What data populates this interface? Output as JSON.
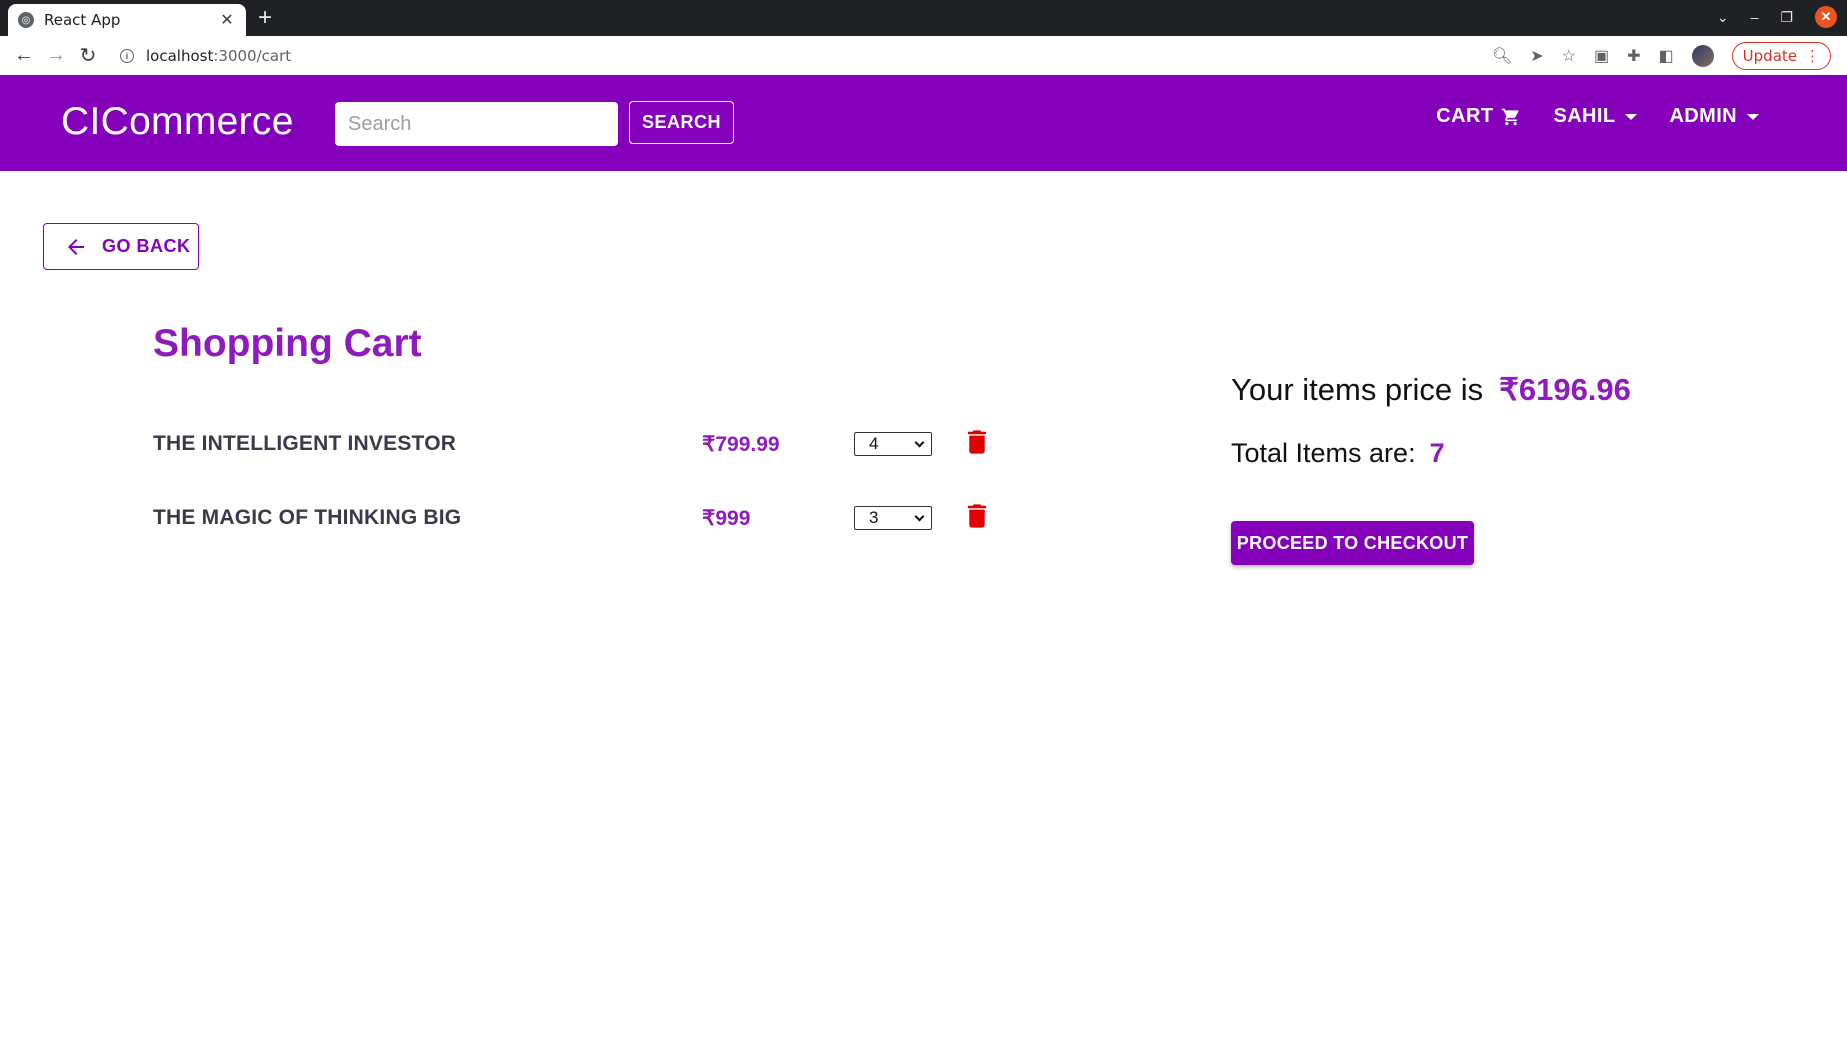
{
  "browser": {
    "tab_title": "React App",
    "url_host": "localhost",
    "url_path": ":3000/cart",
    "update_label": "Update",
    "profile_badge": "1"
  },
  "header": {
    "brand": "CICommerce",
    "search_placeholder": "Search",
    "search_button": "SEARCH",
    "nav": {
      "cart": "CART",
      "user": "SAHIL",
      "admin": "ADMIN"
    }
  },
  "page": {
    "go_back": "GO BACK",
    "title": "Shopping Cart",
    "items": [
      {
        "name": "THE INTELLIGENT INVESTOR",
        "price": "₹799.99",
        "qty": "4"
      },
      {
        "name": "THE MAGIC OF THINKING BIG",
        "price": "₹999",
        "qty": "3"
      }
    ],
    "summary": {
      "price_label": "Your items price is",
      "price_value": "₹6196.96",
      "items_label": "Total Items are:",
      "items_value": "7",
      "checkout": "PROCEED TO CHECKOUT"
    }
  },
  "colors": {
    "primary": "#8400bb",
    "accent_text": "#8e1bbf",
    "delete": "#e00000"
  }
}
